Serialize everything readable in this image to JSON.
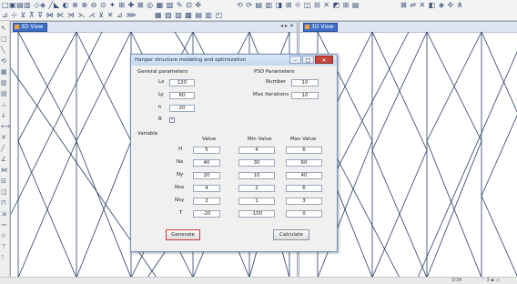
{
  "toolbar": {
    "row1_glyphs": "□▣▤▥ ◇◈ ╱◣ ◐ ⊕ ⊗ ⊖ ⊙ ✦ ⊞ ✚ ⊠ ◎ ▦ ▧ ✎ ⊡ ✜",
    "row1b_glyphs": "⟲ ⟳ ▤ ▥ ◨ ⊞ ⟐ ◫ ⊟ ✕ ◩ ⊞ ▤",
    "row1c_glyphs": "⊠ ⇌ ✕ ◧ ◈ ✣ ⋔",
    "row2_glyphs": "⊿ ⊹ ⊻ ⊼ ⊽ ⋈ ⋉ ⋊ ⋋ ⋌ ⊻ ✕ ⊿ ⋙",
    "row2b_glyphs": "▦ ▧ ▨ ▩ ▤ ▥ ◰"
  },
  "panes": {
    "left_title": "3D View",
    "right_title": "3D View",
    "ctl_glyph": "◂ ▸ ✕"
  },
  "status": {
    "left": "",
    "right1": "3/34",
    "right2": "◦ 3 ▪ ◁"
  },
  "dialog": {
    "title": "Hanger structure modeling and optimization",
    "controls": {
      "minimize": "–",
      "maximize": "□",
      "close": "✕"
    },
    "general": {
      "header": "General parameters",
      "Lx": {
        "label": "Lx",
        "value": "120"
      },
      "Ly": {
        "label": "Ly",
        "value": "60"
      },
      "h": {
        "label": "h",
        "value": "20"
      },
      "b": {
        "label": "B",
        "checked": "✓"
      }
    },
    "pso": {
      "header": "PSO Parameters",
      "number": {
        "label": "Number",
        "value": "10"
      },
      "max_iter": {
        "label": "Max iterations",
        "value": "10"
      }
    },
    "variable": {
      "header": "Variable",
      "columns": [
        "Value",
        "Min Value",
        "Max Value"
      ],
      "rows": [
        {
          "name": "H",
          "value": "5",
          "min": "4",
          "max": "6"
        },
        {
          "name": "Nx",
          "value": "40",
          "min": "30",
          "max": "60"
        },
        {
          "name": "Ny",
          "value": "20",
          "min": "10",
          "max": "40"
        },
        {
          "name": "Nsx",
          "value": "4",
          "min": "2",
          "max": "6"
        },
        {
          "name": "Nsy",
          "value": "2",
          "min": "1",
          "max": "3"
        },
        {
          "name": "T",
          "value": "-20",
          "min": "-100",
          "max": "0"
        }
      ]
    },
    "buttons": {
      "generate": "Generate",
      "calculate": "Calculate"
    }
  }
}
